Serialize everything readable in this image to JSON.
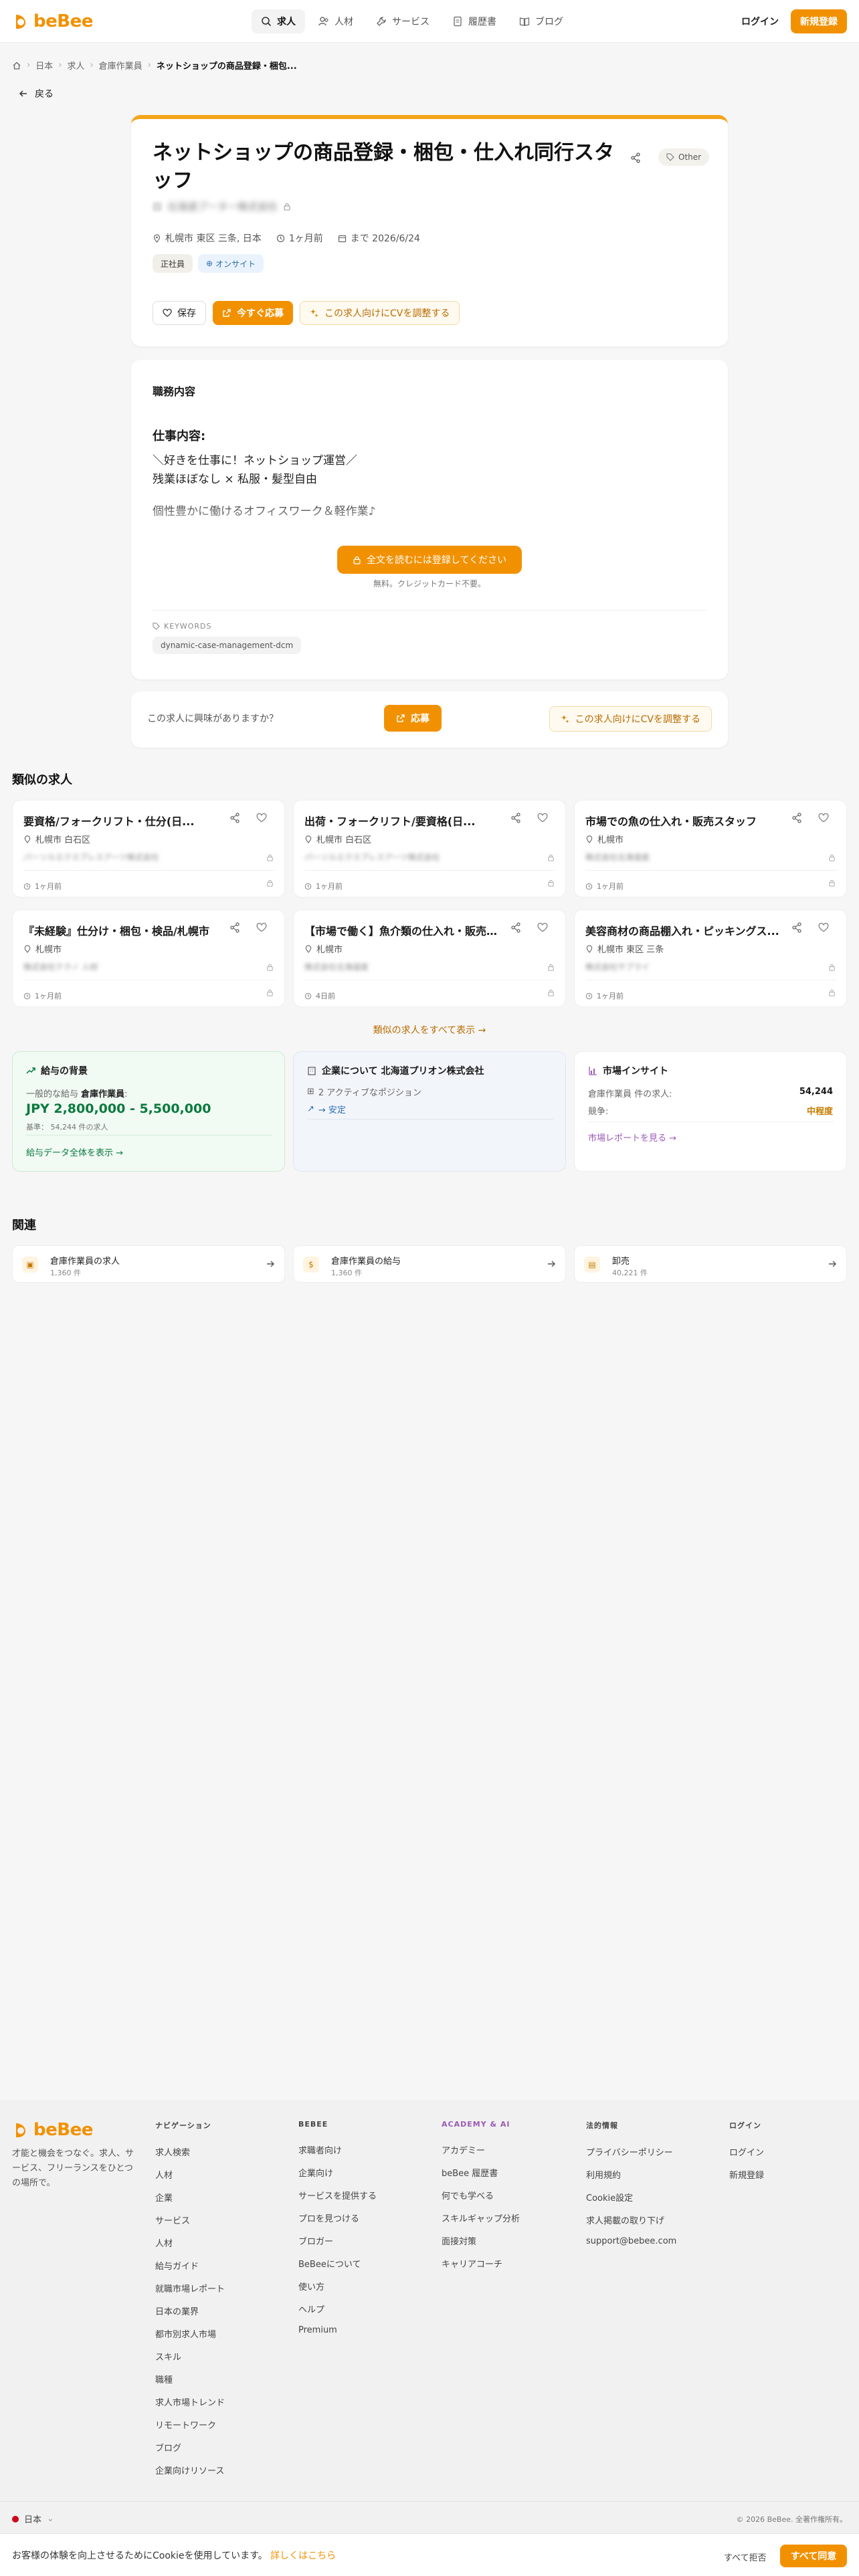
{
  "header": {
    "logo_text": "beBee",
    "nav": [
      {
        "label": "求人",
        "icon": "search-icon",
        "active": true
      },
      {
        "label": "人材",
        "icon": "users-icon",
        "active": false
      },
      {
        "label": "サービス",
        "icon": "wrench-icon",
        "active": false
      },
      {
        "label": "履歴書",
        "icon": "document-icon",
        "active": false
      },
      {
        "label": "ブログ",
        "icon": "book-icon",
        "active": false
      }
    ],
    "login": "ログイン",
    "signup": "新規登録"
  },
  "breadcrumb": [
    "日本",
    "求人",
    "倉庫作業員",
    "ネットショップの商品登録・梱包..."
  ],
  "back": "戻る",
  "job": {
    "title": "ネットショップの商品登録・梱包・仕入れ同行スタッフ",
    "tag": "Other",
    "company": "北海道プーター株式会社",
    "location": "札幌市 東区 三条, 日本",
    "posted": "1ヶ月前",
    "deadline": "まで 2026/6/24",
    "chip_type": "正社員",
    "chip_onsite": "オンサイト",
    "save": "保存",
    "apply_now": "今すぐ応募",
    "adjust_cv": "この求人向けにCVを調整する"
  },
  "description": {
    "heading": "職務内容",
    "sub": "仕事内容:",
    "line1": "＼好きを仕事に！ネットショップ運営／",
    "line2": "残業ほぼなし × 私服・髪型自由",
    "line3": "個性豊かに働けるオフィスワーク＆軽作業♪",
    "unlock": "全文を読むには登録してください",
    "unlock_note": "無料。クレジットカード不要。",
    "keywords_label": "KEYWORDS",
    "keyword": "dynamic-case-management-dcm"
  },
  "interest": {
    "question": "この求人に興味がありますか？",
    "apply": "応募",
    "adjust_cv": "この求人向けにCVを調整する"
  },
  "similar": {
    "title": "類似の求人",
    "show_all": "類似の求人をすべて表示 →",
    "jobs": [
      {
        "title": "要資格/フォークリフト・仕分(日...",
        "location": "札幌市 白石区",
        "company": "パーソルエクスプレスアーツ株式会社",
        "time": "1ヶ月前"
      },
      {
        "title": "出荷・フォークリフト/要資格(日...",
        "location": "札幌市 白石区",
        "company": "パーソルエクスプレスアーツ株式会社",
        "time": "1ヶ月前"
      },
      {
        "title": "市場での魚の仕入れ・販売スタッフ",
        "location": "札幌市",
        "company": "株式会社北海道産",
        "time": "1ヶ月前"
      },
      {
        "title": "『未経験』仕分け・梱包・検品/札幌市",
        "location": "札幌市",
        "company": "株式会社テクノ 人材",
        "time": "1ヶ月前"
      },
      {
        "title": "【市場で働く】魚介類の仕入れ・販売...",
        "location": "札幌市",
        "company": "株式会社北海道産",
        "time": "4日前"
      },
      {
        "title": "美容商材の商品棚入れ・ピッキングス...",
        "location": "札幌市 東区 三条",
        "company": "株式会社サプライ",
        "time": "1ヶ月前"
      }
    ]
  },
  "insights": {
    "salary_head": "給与の背景",
    "salary_label": "一般的な給与",
    "salary_role": "倉庫作業員",
    "salary_range": "JPY 2,800,000 - 5,500,000",
    "salary_basis": "基準： 54,244 件の求人",
    "salary_link": "給与データ全体を表示 →",
    "company_head": "企業について 北海道プリオン株式会社",
    "company_positions": "2 アクティブなポジション",
    "company_trend": "→ 安定",
    "market_head": "市場インサイト",
    "market_jobs_label": "倉庫作業員 件の求人:",
    "market_jobs_value": "54,244",
    "market_comp_label": "競争:",
    "market_comp_value": "中程度",
    "market_link": "市場レポートを見る →"
  },
  "related": {
    "title": "関連",
    "items": [
      {
        "label": "倉庫作業員の求人",
        "count": "1,360 件",
        "icon": "briefcase-icon"
      },
      {
        "label": "倉庫作業員の給与",
        "count": "1,360 件",
        "icon": "dollar-icon"
      },
      {
        "label": "卸売",
        "count": "40,221 件",
        "icon": "building-icon"
      }
    ]
  },
  "footer": {
    "tagline": "才能と機会をつなぐ。求人、サービス、フリーランスをひとつの場所で。",
    "cols": [
      {
        "head": "ナビゲーション",
        "links": [
          "求人検索",
          "人材",
          "企業",
          "サービス",
          "人材",
          "給与ガイド",
          "就職市場レポート",
          "日本の業界",
          "都市別求人市場",
          "スキル",
          "職種",
          "求人市場トレンド",
          "リモートワーク",
          "ブログ",
          "企業向けリソース"
        ]
      },
      {
        "head": "BEBEE",
        "links": [
          "求職者向け",
          "企業向け",
          "サービスを提供する",
          "プロを見つける",
          "ブロガー",
          "BeBeeについて",
          "使い方",
          "ヘルプ",
          "Premium"
        ]
      },
      {
        "head": "ACADEMY & AI",
        "links": [
          "アカデミー",
          "beBee 履歴書",
          "何でも学べる",
          "スキルギャップ分析",
          "面接対策",
          "キャリアコーチ"
        ]
      },
      {
        "head": "法的情報",
        "links": [
          "プライバシーポリシー",
          "利用規約",
          "Cookie設定",
          "求人掲載の取り下げ",
          "support@bebee.com"
        ]
      },
      {
        "head": "ログイン",
        "links": [
          "ログイン",
          "新規登録"
        ]
      }
    ],
    "lang": "日本",
    "copyright": "© 2026 BeBee. 全著作権所有。"
  },
  "cookie": {
    "text": "お客様の体験を向上させるためにCookieを使用しています。",
    "link": "詳しくはこちら",
    "decline": "すべて拒否",
    "accept": "すべて同意"
  },
  "colors": {
    "accent": "#f29100",
    "salary": "#0a7a3e",
    "purple": "#9b59b6"
  }
}
